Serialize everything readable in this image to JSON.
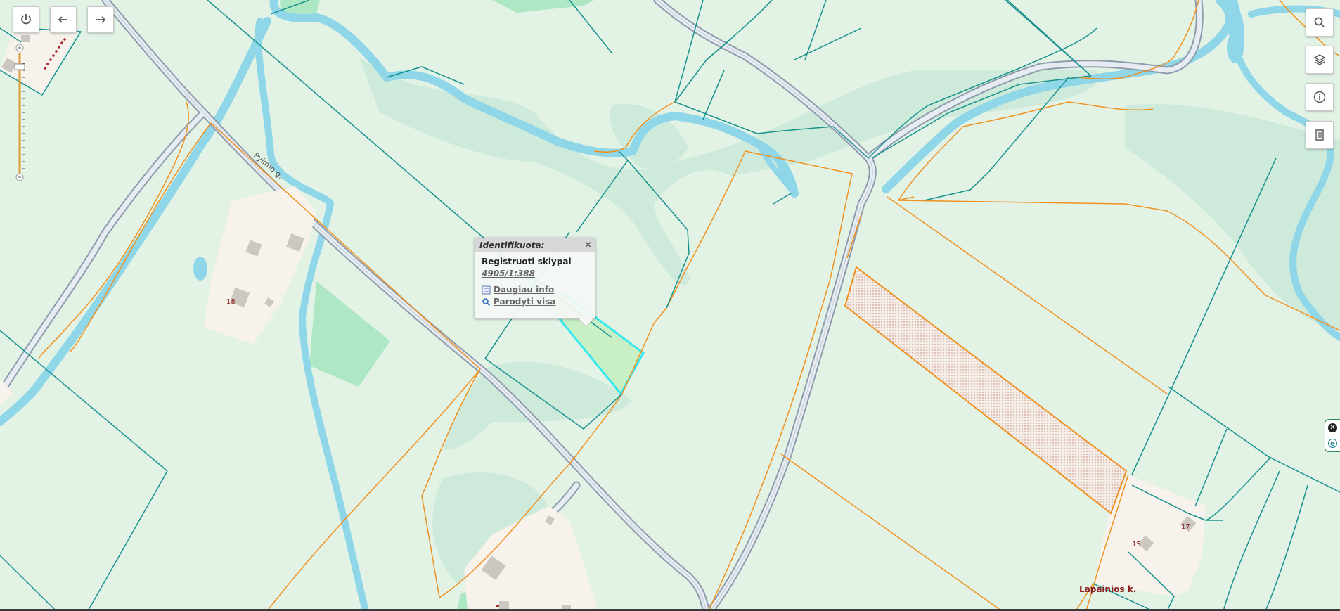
{
  "map": {
    "road_label": "Pylimo g.",
    "village_label": "Lapainios k.",
    "house_numbers": [
      "18",
      "15",
      "17"
    ]
  },
  "popup": {
    "header": "Identifikuota:",
    "close_symbol": "×",
    "layer_title": "Registruoti sklypai",
    "parcel_id": "4905/1:388",
    "more_info_label": "Daugiau info",
    "show_all_label": "Parodyti visa"
  },
  "toolbar": {
    "power_icon": "power-icon",
    "back_icon": "arrow-left-icon",
    "forward_icon": "arrow-right-icon",
    "search_icon": "search-icon",
    "layers_icon": "layers-icon",
    "info_icon": "info-icon",
    "legend_icon": "document-icon"
  },
  "colors": {
    "background": "#e2f3e6",
    "water": "#8fd7e8",
    "parcel_teal": "#17918d",
    "parcel_orange": "#f0901e",
    "selected_parcel": "#34e8ee",
    "building_area": "#f7f2ec",
    "building": "#cdc7c1",
    "road": "#b9c3cd"
  }
}
